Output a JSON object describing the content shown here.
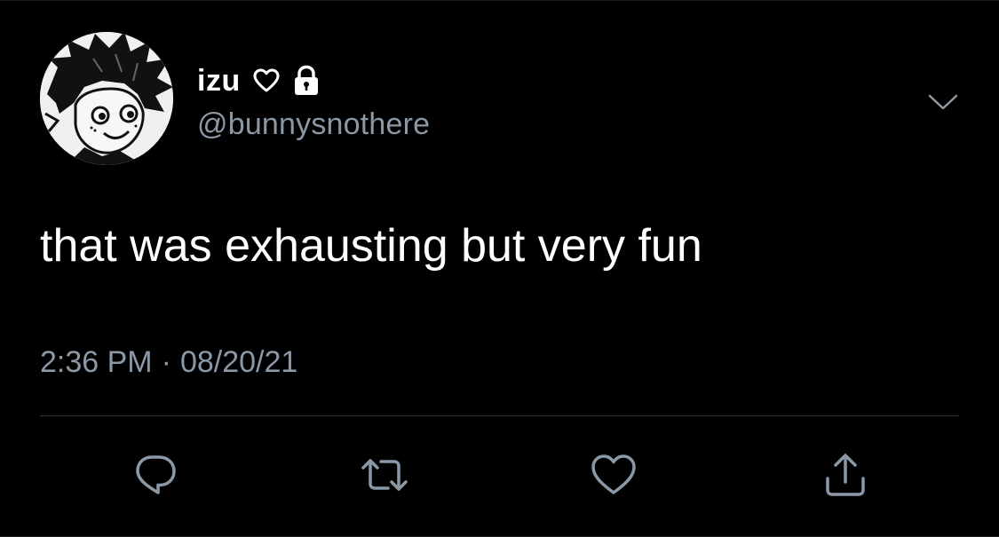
{
  "profile": {
    "display_name": "izu",
    "handle": "@bunnysnothere",
    "name_icons": [
      "heart-outline-icon",
      "lock-icon"
    ]
  },
  "tweet": {
    "text": "that was exhausting but very fun",
    "time": "2:36 PM",
    "separator": "·",
    "date": "08/20/21"
  },
  "actions": [
    "reply-icon",
    "retweet-icon",
    "like-icon",
    "share-icon"
  ],
  "colors": {
    "background": "#000000",
    "primary_text": "#ffffff",
    "secondary_text": "#8b98a5",
    "divider": "#2f3336"
  }
}
